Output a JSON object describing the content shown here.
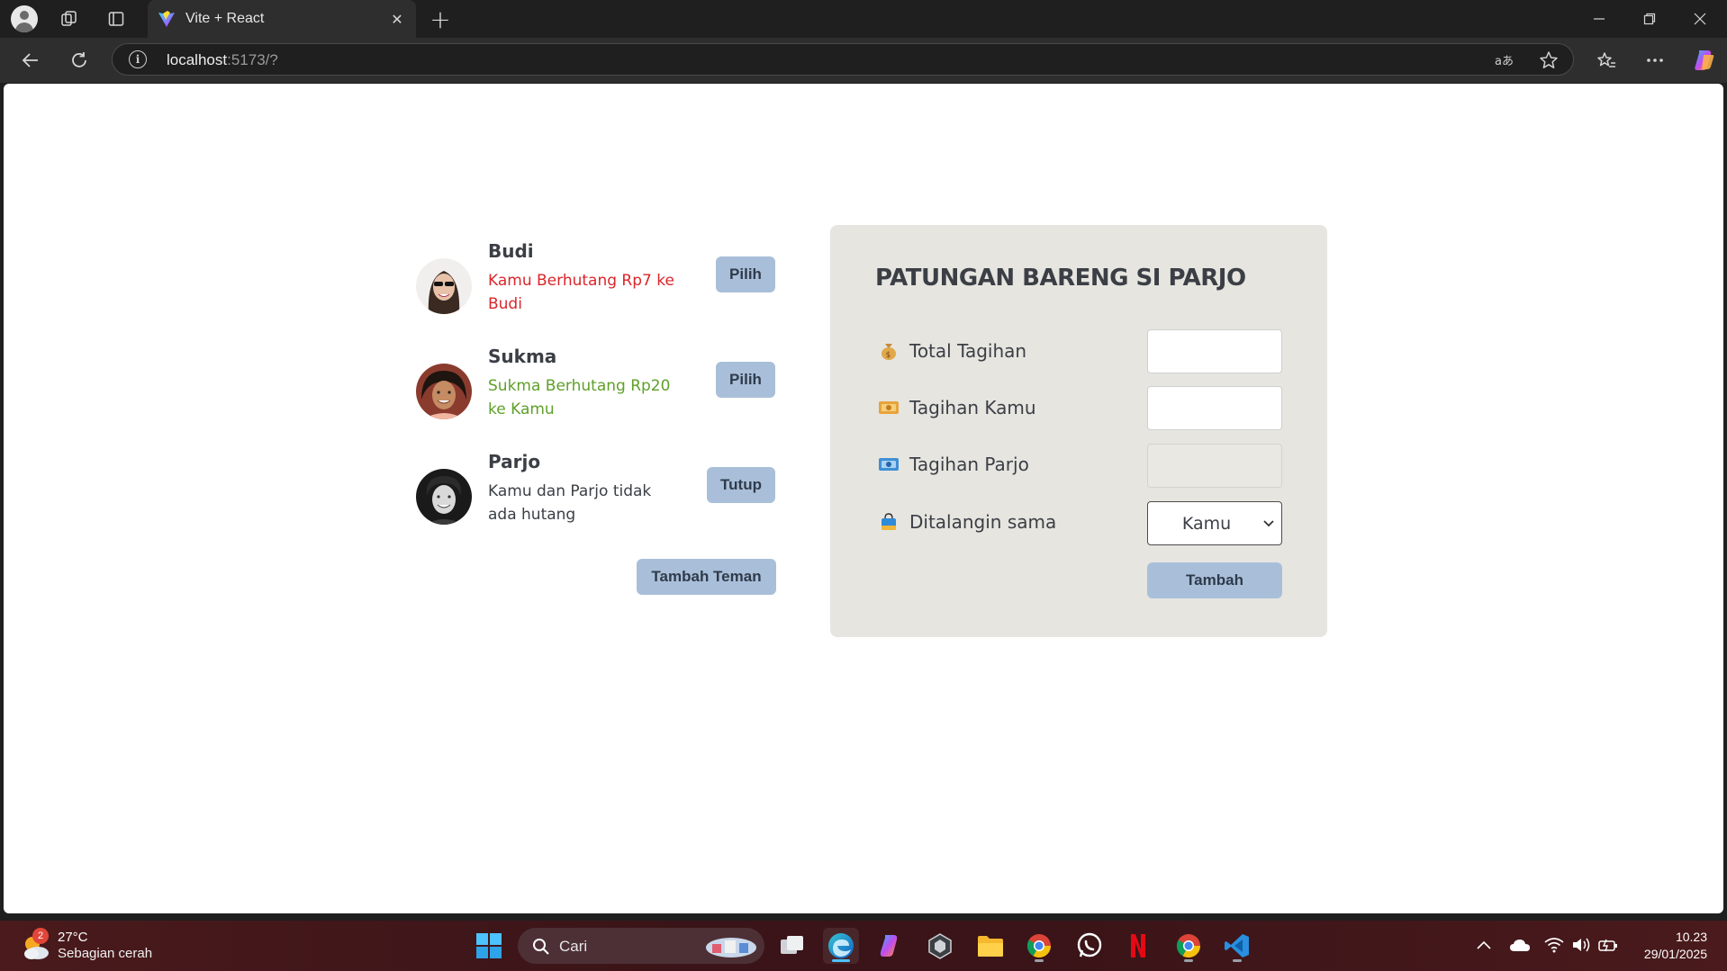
{
  "browser": {
    "tab_title": "Vite + React",
    "url_host": "localhost",
    "url_rest": ":5173/?"
  },
  "friends": [
    {
      "name": "Budi",
      "status": "Kamu Berhutang Rp7 ke Budi",
      "status_color": "#d9262b",
      "button": "Pilih"
    },
    {
      "name": "Sukma",
      "status": "Sukma Berhutang Rp20 ke Kamu",
      "status_color": "#5fa02a",
      "button": "Pilih"
    },
    {
      "name": "Parjo",
      "status": "Kamu dan Parjo tidak ada hutang",
      "status_color": "#3b3f45",
      "button": "Tutup"
    }
  ],
  "add_friend_button": "Tambah Teman",
  "form": {
    "title": "PATUNGAN BARENG SI PARJO",
    "total_label": "Total Tagihan",
    "total_value": "",
    "yours_label": "Tagihan Kamu",
    "yours_value": "",
    "friend_label": "Tagihan Parjo",
    "friend_value": "",
    "payer_label": "Ditalangin sama",
    "payer_value": "Kamu",
    "submit": "Tambah"
  },
  "taskbar": {
    "weather_badge": "2",
    "weather_temp": "27°C",
    "weather_desc": "Sebagian cerah",
    "search_placeholder": "Cari",
    "time": "10.23",
    "date": "29/01/2025"
  },
  "colors": {
    "button_bg": "#a9bfd9",
    "card_bg": "#e6e5e0",
    "text_dark": "#3b3f45"
  }
}
